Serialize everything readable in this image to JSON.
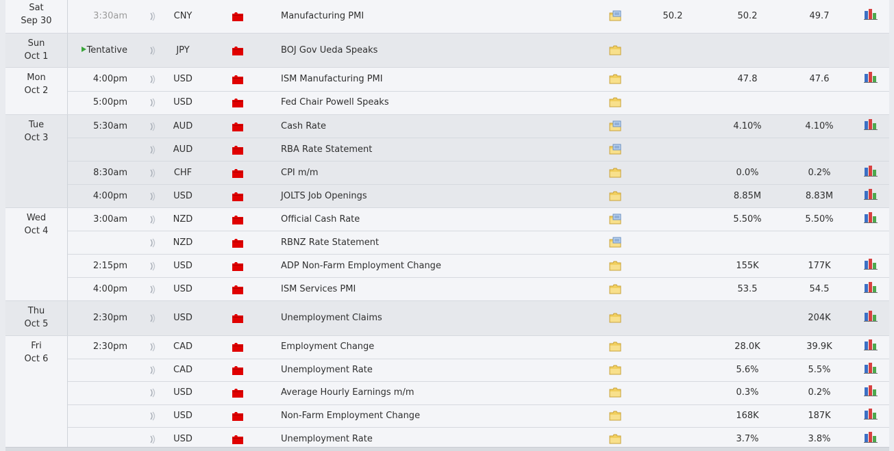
{
  "days": [
    {
      "day": "Sat",
      "date": "Sep 30",
      "height": 48,
      "theme": "light",
      "top_pad": -3,
      "events": [
        {
          "time": "3:30am",
          "past": true,
          "currency": "CNY",
          "event": "Manufacturing PMI",
          "folder": "blue",
          "actual": "50.2",
          "forecast": "50.2",
          "previous": "49.7",
          "graph": true
        }
      ]
    },
    {
      "day": "Sun",
      "date": "Oct 1",
      "height": 49,
      "theme": "dark",
      "events": [
        {
          "time": "Tentative",
          "tentative": true,
          "currency": "JPY",
          "event": "BOJ Gov Ueda Speaks",
          "folder": "yellow",
          "actual": "",
          "forecast": "",
          "previous": "",
          "graph": false
        }
      ]
    },
    {
      "day": "Mon",
      "date": "Oct 2",
      "height": 68,
      "theme": "light",
      "events": [
        {
          "time": "4:00pm",
          "currency": "USD",
          "event": "ISM Manufacturing PMI",
          "folder": "yellow",
          "actual": "",
          "forecast": "47.8",
          "previous": "47.6",
          "graph": true
        },
        {
          "time": "5:00pm",
          "currency": "USD",
          "event": "Fed Chair Powell Speaks",
          "folder": "yellow",
          "actual": "",
          "forecast": "",
          "previous": "",
          "graph": false
        }
      ]
    },
    {
      "day": "Tue",
      "date": "Oct 3",
      "height": 135,
      "theme": "dark",
      "events": [
        {
          "time": "5:30am",
          "currency": "AUD",
          "event": "Cash Rate",
          "folder": "blue",
          "actual": "",
          "forecast": "4.10%",
          "previous": "4.10%",
          "graph": true
        },
        {
          "time": "",
          "currency": "AUD",
          "event": "RBA Rate Statement",
          "folder": "blue",
          "actual": "",
          "forecast": "",
          "previous": "",
          "graph": false
        },
        {
          "time": "8:30am",
          "currency": "CHF",
          "event": "CPI m/m",
          "folder": "yellow",
          "actual": "",
          "forecast": "0.0%",
          "previous": "0.2%",
          "graph": true
        },
        {
          "time": "4:00pm",
          "currency": "USD",
          "event": "JOLTS Job Openings",
          "folder": "yellow",
          "actual": "",
          "forecast": "8.85M",
          "previous": "8.83M",
          "graph": true
        }
      ]
    },
    {
      "day": "Wed",
      "date": "Oct 4",
      "height": 135,
      "theme": "light",
      "events": [
        {
          "time": "3:00am",
          "currency": "NZD",
          "event": "Official Cash Rate",
          "folder": "blue",
          "actual": "",
          "forecast": "5.50%",
          "previous": "5.50%",
          "graph": true
        },
        {
          "time": "",
          "currency": "NZD",
          "event": "RBNZ Rate Statement",
          "folder": "blue",
          "actual": "",
          "forecast": "",
          "previous": "",
          "graph": false
        },
        {
          "time": "2:15pm",
          "currency": "USD",
          "event": "ADP Non-Farm Employment Change",
          "folder": "yellow",
          "actual": "",
          "forecast": "155K",
          "previous": "177K",
          "graph": true
        },
        {
          "time": "4:00pm",
          "currency": "USD",
          "event": "ISM Services PMI",
          "folder": "yellow",
          "actual": "",
          "forecast": "53.5",
          "previous": "54.5",
          "graph": true
        }
      ]
    },
    {
      "day": "Thu",
      "date": "Oct 5",
      "height": 50,
      "theme": "dark",
      "events": [
        {
          "time": "2:30pm",
          "currency": "USD",
          "event": "Unemployment Claims",
          "folder": "yellow",
          "actual": "",
          "forecast": "",
          "previous": "204K",
          "graph": true
        }
      ]
    },
    {
      "day": "Fri",
      "date": "Oct 6",
      "height": 167,
      "theme": "light",
      "events": [
        {
          "time": "2:30pm",
          "currency": "CAD",
          "event": "Employment Change",
          "folder": "yellow",
          "actual": "",
          "forecast": "28.0K",
          "previous": "39.9K",
          "graph": true
        },
        {
          "time": "",
          "currency": "CAD",
          "event": "Unemployment Rate",
          "folder": "yellow",
          "actual": "",
          "forecast": "5.6%",
          "previous": "5.5%",
          "graph": true
        },
        {
          "time": "",
          "currency": "USD",
          "event": "Average Hourly Earnings m/m",
          "folder": "yellow",
          "actual": "",
          "forecast": "0.3%",
          "previous": "0.2%",
          "graph": true
        },
        {
          "time": "",
          "currency": "USD",
          "event": "Non-Farm Employment Change",
          "folder": "yellow",
          "actual": "",
          "forecast": "168K",
          "previous": "187K",
          "graph": true
        },
        {
          "time": "",
          "currency": "USD",
          "event": "Unemployment Rate",
          "folder": "yellow",
          "actual": "",
          "forecast": "3.7%",
          "previous": "3.8%",
          "graph": true
        }
      ]
    }
  ],
  "icons": {
    "sound": "sound-wave-icon",
    "impact": "high-impact-folder-icon",
    "folder_yellow": "event-detail-folder-icon",
    "folder_blue": "event-detail-folder-updated-icon",
    "graph": "bar-chart-icon"
  },
  "colors": {
    "impact_red": "#e00000",
    "tentative_green": "#3aa63a",
    "bar_blue": "#3b6fc4",
    "bar_red": "#d84040",
    "bar_green": "#4da84d"
  }
}
